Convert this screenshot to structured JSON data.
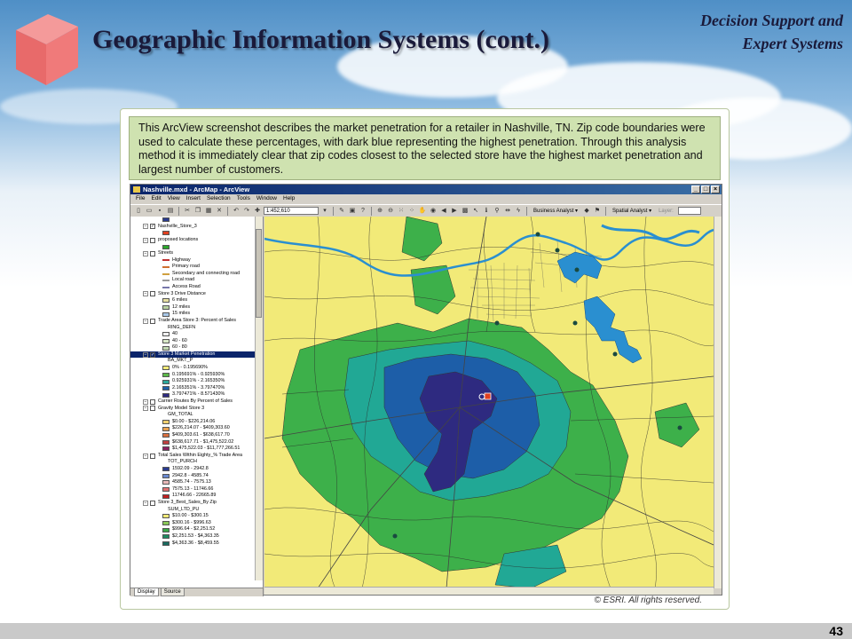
{
  "slide": {
    "title": "Geographic Information Systems (cont.)",
    "header_line1": "Decision Support and",
    "header_line2": "Expert Systems",
    "page_number": "43"
  },
  "figure": {
    "caption": "This ArcView screenshot describes the market penetration for a retailer in Nashville, TN. Zip code boundaries were used to calculate these percentages, with dark blue representing the highest penetration. Through this analysis method it is immediately clear that zip codes closest to the selected store have the highest market penetration and largest number of customers.",
    "copyright": "© ESRI. All rights reserved."
  },
  "app": {
    "window_title": "Nashville.mxd - ArcMap - ArcView",
    "menus": [
      "File",
      "Edit",
      "View",
      "Insert",
      "Selection",
      "Tools",
      "Window",
      "Help"
    ],
    "scale_value": "1:452,610",
    "toolbar_business_analyst": "Business Analyst ▾",
    "toolbar_spatial_analyst": "Spatial Analyst ▾",
    "toolbar_layer": "Layer:",
    "tabs": [
      "Display",
      "Source"
    ],
    "toc": [
      {
        "kind": "swatch",
        "label": "",
        "color": "#2a3b8f"
      },
      {
        "kind": "layer",
        "label": "Nashville_Store_3",
        "checked": true
      },
      {
        "kind": "swatch",
        "label": "",
        "color": "#e04020"
      },
      {
        "kind": "layer",
        "label": "proposed locations",
        "checked": false
      },
      {
        "kind": "swatch",
        "label": "",
        "color": "#2da82d"
      },
      {
        "kind": "layer",
        "label": "Streets",
        "checked": false
      },
      {
        "kind": "line",
        "label": "Highway",
        "color": "#c03030"
      },
      {
        "kind": "line",
        "label": "Primary road",
        "color": "#d07030"
      },
      {
        "kind": "line",
        "label": "Secondary and connecting road",
        "color": "#d0a040"
      },
      {
        "kind": "line",
        "label": "Local road",
        "color": "#999999"
      },
      {
        "kind": "line",
        "label": "Access Road",
        "color": "#7777aa"
      },
      {
        "kind": "layer",
        "label": "Store 3 Drive Distance",
        "checked": false
      },
      {
        "kind": "swatch",
        "label": "6 miles",
        "color": "#e8e0a0"
      },
      {
        "kind": "swatch",
        "label": "12 miles",
        "color": "#b9d2a0"
      },
      {
        "kind": "swatch",
        "label": "15 miles",
        "color": "#a8c8e8"
      },
      {
        "kind": "layer",
        "label": "Trade Area Store 3: Percent of Sales",
        "checked": false
      },
      {
        "kind": "field",
        "label": "RING_DEFN"
      },
      {
        "kind": "swatch",
        "label": "40",
        "color": "#f0f0f0"
      },
      {
        "kind": "swatch",
        "label": "40 - 60",
        "color": "#d8e8c8"
      },
      {
        "kind": "swatch",
        "label": "60 - 80",
        "color": "#c0d8b0"
      },
      {
        "kind": "layer",
        "label": "Store 3 Market Penetration",
        "checked": true,
        "selected": true
      },
      {
        "kind": "field",
        "label": "BA_MKT_P"
      },
      {
        "kind": "swatch",
        "label": "0% - 0.195690%",
        "color": "#f2ea78"
      },
      {
        "kind": "swatch",
        "label": "0.195691% - 0.925930%",
        "color": "#5cb84a"
      },
      {
        "kind": "swatch",
        "label": "0.925931% - 2.165350%",
        "color": "#2ca89a"
      },
      {
        "kind": "swatch",
        "label": "2.165351% - 3.797470%",
        "color": "#1f5fa8"
      },
      {
        "kind": "swatch",
        "label": "3.797471% - 8.571430%",
        "color": "#2e2a80"
      },
      {
        "kind": "layer",
        "label": "Carrier Routes By Percent of Sales",
        "checked": false
      },
      {
        "kind": "layer",
        "label": "Gravity Model Store 3",
        "checked": false
      },
      {
        "kind": "field",
        "label": "GM_TOTAL"
      },
      {
        "kind": "swatch",
        "label": "$0.00 - $226,214.06",
        "color": "#f0d070"
      },
      {
        "kind": "swatch",
        "label": "$226,214.07 - $409,303.60",
        "color": "#e8a050"
      },
      {
        "kind": "swatch",
        "label": "$409,303.61 - $638,617.70",
        "color": "#d87040"
      },
      {
        "kind": "swatch",
        "label": "$638,617.71 - $1,475,522.02",
        "color": "#c04040"
      },
      {
        "kind": "swatch",
        "label": "$1,475,522.03 - $11,777,266.51",
        "color": "#8a2060"
      },
      {
        "kind": "layer",
        "label": "Total Sales Within Eighty_% Trade Area",
        "checked": false
      },
      {
        "kind": "field",
        "label": "TOT_PURCH"
      },
      {
        "kind": "swatch",
        "label": "1592.09 - 2942.8",
        "color": "#2a3b8f"
      },
      {
        "kind": "swatch",
        "label": "2942.8 - 4585.74",
        "color": "#6a8ad0"
      },
      {
        "kind": "swatch",
        "label": "4585.74 - 7575.13",
        "color": "#e8b8b8"
      },
      {
        "kind": "swatch",
        "label": "7575.13 - 11746.66",
        "color": "#e07070"
      },
      {
        "kind": "swatch",
        "label": "11746.66 - 22665.89",
        "color": "#c02020"
      },
      {
        "kind": "layer",
        "label": "Store 3_Best_Sales_By Zip",
        "checked": false
      },
      {
        "kind": "field",
        "label": "SUM_LTD_PU"
      },
      {
        "kind": "swatch",
        "label": "$10.00 - $300.15",
        "color": "#f2ea78"
      },
      {
        "kind": "swatch",
        "label": "$300.16 - $996.63",
        "color": "#8ac858"
      },
      {
        "kind": "swatch",
        "label": "$996.64 - $2,251.52",
        "color": "#3aa848"
      },
      {
        "kind": "swatch",
        "label": "$2,251.53 - $4,363.35",
        "color": "#1f8a60"
      },
      {
        "kind": "swatch",
        "label": "$4,363.36 - $8,459.55",
        "color": "#1a6a60"
      }
    ]
  },
  "colors": {
    "yellow": "#f2ea78",
    "green": "#3db04a",
    "teal": "#21a895",
    "blue": "#1d5ea8",
    "navy": "#2e2a80",
    "water": "#2a8fd0"
  },
  "icons": [
    "new-icon",
    "open-icon",
    "save-icon",
    "print-icon",
    "cut-icon",
    "copy-icon",
    "paste-icon",
    "delete-icon",
    "undo-icon",
    "redo-icon",
    "add-data-icon",
    "zoom-in-icon",
    "zoom-out-icon",
    "pan-icon",
    "full-extent-icon",
    "select-icon",
    "identify-icon",
    "find-icon",
    "measure-icon"
  ]
}
